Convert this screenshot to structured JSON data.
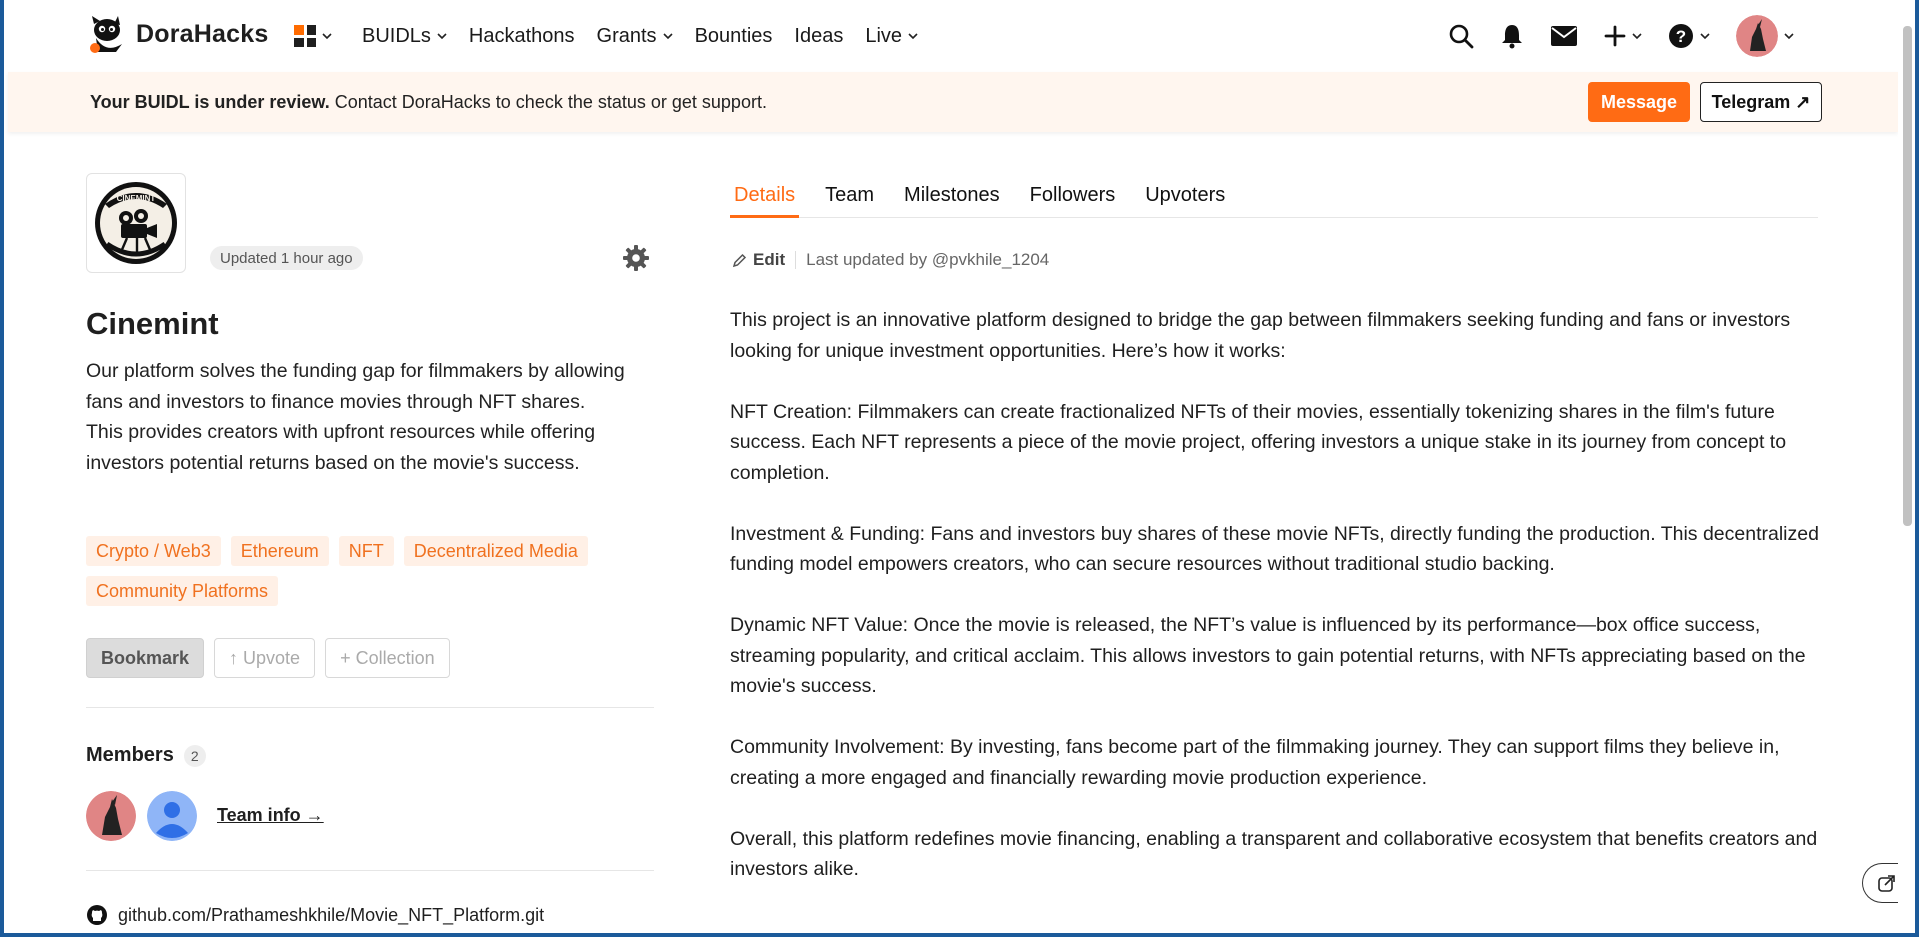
{
  "brand": {
    "name": "DoraHacks"
  },
  "nav": {
    "items": [
      {
        "label": "BUIDLs",
        "dropdown": true
      },
      {
        "label": "Hackathons",
        "dropdown": false
      },
      {
        "label": "Grants",
        "dropdown": true
      },
      {
        "label": "Bounties",
        "dropdown": false
      },
      {
        "label": "Ideas",
        "dropdown": false
      },
      {
        "label": "Live",
        "dropdown": true
      }
    ],
    "right_icons": [
      "search-icon",
      "bell-icon",
      "mail-icon",
      "plus-icon",
      "help-icon",
      "user-avatar"
    ]
  },
  "banner": {
    "bold": "Your BUIDL is under review.",
    "text": " Contact DoraHacks to check the status or get support.",
    "message_label": "Message",
    "telegram_label": "Telegram ↗"
  },
  "project": {
    "updated": "Updated 1 hour ago",
    "title": "Cinemint",
    "description": "Our platform solves the funding gap for filmmakers by allowing fans and investors to finance movies through NFT shares. This provides creators with upfront resources while offering investors potential returns based on the movie's success.",
    "tags": [
      "Crypto / Web3",
      "Ethereum",
      "NFT",
      "Decentralized Media",
      "Community Platforms"
    ],
    "actions": {
      "bookmark": "Bookmark",
      "upvote": "↑ Upvote",
      "collection": "+ Collection"
    },
    "members_title": "Members",
    "members_count": "2",
    "team_info": "Team info →",
    "github": "github.com/Prathameshkhile/Movie_NFT_Platform.git"
  },
  "tabs": [
    "Details",
    "Team",
    "Milestones",
    "Followers",
    "Upvoters"
  ],
  "details": {
    "edit_label": "Edit",
    "last_updated": "Last updated by @pvkhile_1204",
    "paragraphs": [
      "This project is an innovative platform designed to bridge the gap between filmmakers seeking funding and fans or investors looking for unique investment opportunities. Here’s how it works:",
      "NFT Creation: Filmmakers can create fractionalized NFTs of their movies, essentially tokenizing shares in the film's future success. Each NFT represents a piece of the movie project, offering investors a unique stake in its journey from concept to completion.",
      "Investment & Funding: Fans and investors buy shares of these movie NFTs, directly funding the production. This decentralized funding model empowers creators, who can secure resources without traditional studio backing.",
      "Dynamic NFT Value: Once the movie is released, the NFT’s value is influenced by its performance—box office success, streaming popularity, and critical acclaim. This allows investors to gain potential returns, with NFTs appreciating based on the movie's success.",
      "Community Involvement: By investing, fans become part of the filmmaking journey. They can support films they believe in, creating a more engaged and financially rewarding movie production experience.",
      "Overall, this platform redefines movie financing, enabling a transparent and collaborative ecosystem that benefits creators and investors alike."
    ]
  },
  "colors": {
    "accent": "#ff6b14",
    "tag_bg": "#fff0e6",
    "tag_text": "#f0711f",
    "banner_bg": "#fff6ef"
  }
}
